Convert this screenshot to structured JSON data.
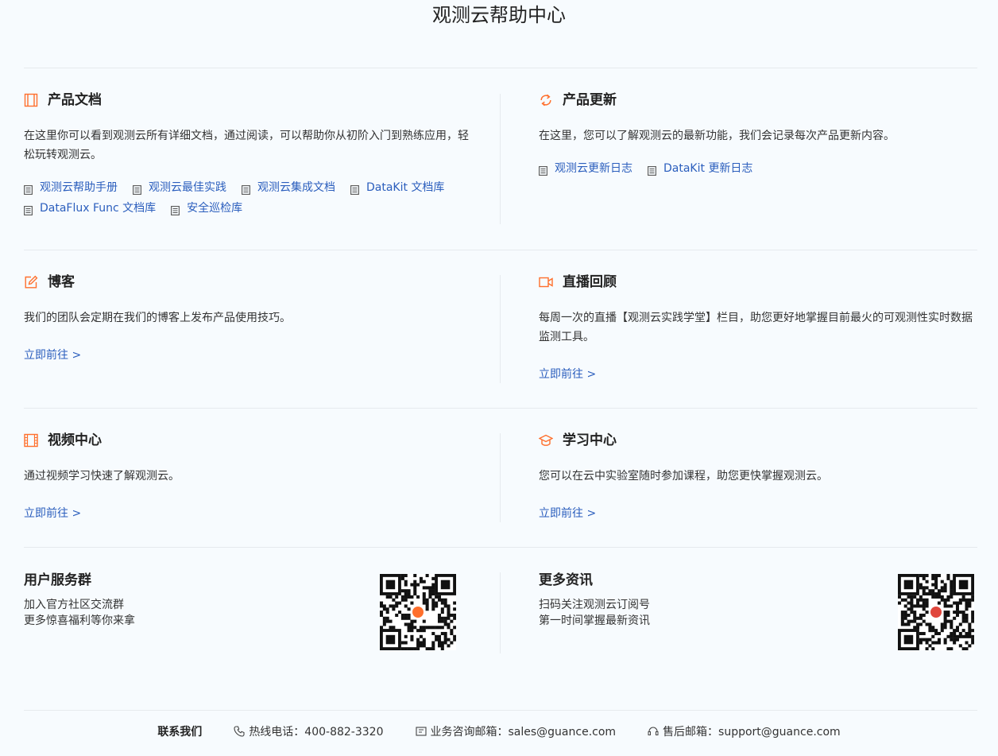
{
  "page": {
    "title": "观测云帮助中心"
  },
  "sections": {
    "docs": {
      "title": "产品文档",
      "desc": "在这里你可以看到观测云所有详细文档，通过阅读，可以帮助你从初阶入门到熟练应用，轻松玩转观测云。",
      "links": [
        "观测云帮助手册",
        "观测云最佳实践",
        "观测云集成文档",
        "DataKit 文档库",
        "DataFlux Func 文档库",
        "安全巡检库"
      ]
    },
    "updates": {
      "title": "产品更新",
      "desc": "在这里，您可以了解观测云的最新功能，我们会记录每次产品更新内容。",
      "links": [
        "观测云更新日志",
        "DataKit 更新日志"
      ]
    },
    "blog": {
      "title": "博客",
      "desc": "我们的团队会定期在我们的博客上发布产品使用技巧。",
      "link": "立即前往 >"
    },
    "live": {
      "title": "直播回顾",
      "desc": "每周一次的直播【观测云实践学堂】栏目，助您更好地掌握目前最火的可观测性实时数据监测工具。",
      "link": "立即前往 >"
    },
    "video": {
      "title": "视频中心",
      "desc": "通过视频学习快速了解观测云。",
      "link": "立即前往 >"
    },
    "learn": {
      "title": "学习中心",
      "desc": "您可以在云中实验室随时参加课程，助您更快掌握观测云。",
      "link": "立即前往 >"
    }
  },
  "community": {
    "title": "用户服务群",
    "line1": "加入官方社区交流群",
    "line2": "更多惊喜福利等你来拿"
  },
  "news": {
    "title": "更多资讯",
    "line1": "扫码关注观测云订阅号",
    "line2": "第一时间掌握最新资讯"
  },
  "footer": {
    "contact_label": "联系我们",
    "hotline": "热线电话：400-882-3320",
    "sales": "业务咨询邮箱：sales@guance.com",
    "support": "售后邮箱：support@guance.com"
  },
  "colors": {
    "accent": "#ff6f2c",
    "link": "#2b5ebd",
    "background": "#f7fbfe"
  },
  "icons": [
    "book-icon",
    "refresh-icon",
    "edit-icon",
    "video-camera-icon",
    "film-icon",
    "graduation-cap-icon",
    "document-icon",
    "phone-icon",
    "mail-icon",
    "headset-icon",
    "qr-code"
  ]
}
